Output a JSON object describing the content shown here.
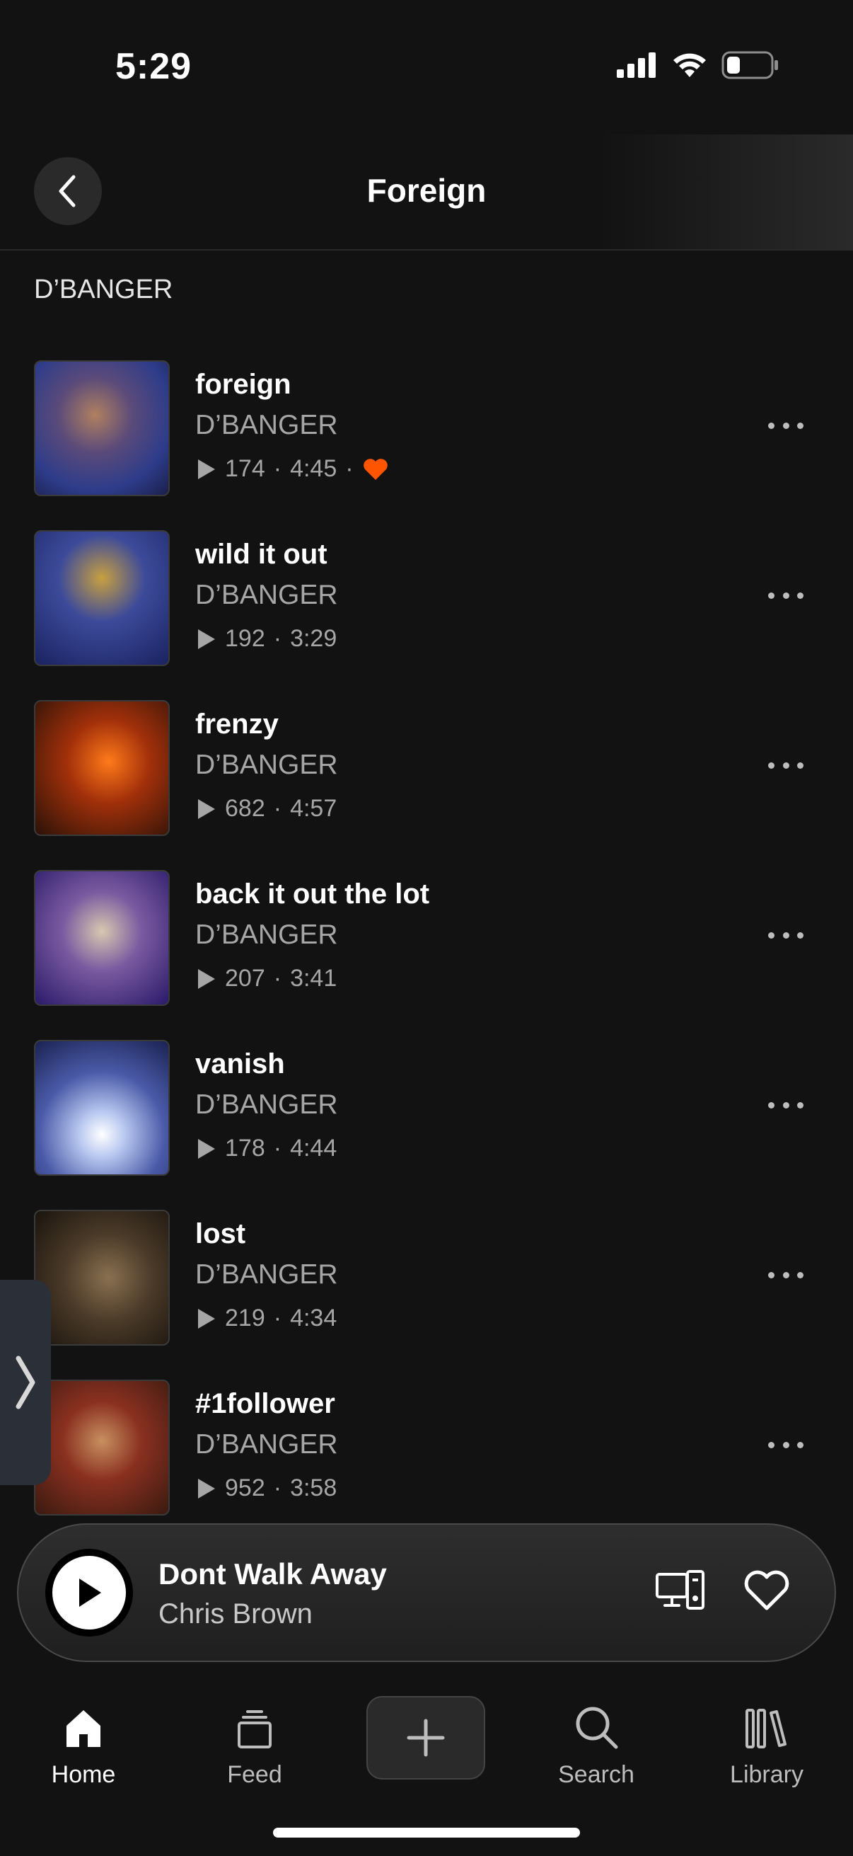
{
  "status_bar": {
    "time": "5:29"
  },
  "header": {
    "title": "Foreign"
  },
  "section": {
    "label": "D’BANGER"
  },
  "tracks": [
    {
      "title": "foreign",
      "artist": "D’BANGER",
      "plays": "174",
      "duration": "4:45",
      "liked": true
    },
    {
      "title": "wild it out",
      "artist": "D’BANGER",
      "plays": "192",
      "duration": "3:29",
      "liked": false
    },
    {
      "title": "frenzy",
      "artist": "D’BANGER",
      "plays": "682",
      "duration": "4:57",
      "liked": false
    },
    {
      "title": "back it out the lot",
      "artist": "D’BANGER",
      "plays": "207",
      "duration": "3:41",
      "liked": false
    },
    {
      "title": "vanish",
      "artist": "D’BANGER",
      "plays": "178",
      "duration": "4:44",
      "liked": false
    },
    {
      "title": "lost",
      "artist": "D’BANGER",
      "plays": "219",
      "duration": "4:34",
      "liked": false
    },
    {
      "title": "#1follower",
      "artist": "D’BANGER",
      "plays": "952",
      "duration": "3:58",
      "liked": false
    }
  ],
  "mini_player": {
    "title": "Dont Walk Away",
    "artist": "Chris Brown"
  },
  "nav": {
    "home": "Home",
    "feed": "Feed",
    "search": "Search",
    "library": "Library"
  },
  "colors": {
    "accent": "#ff5500",
    "background": "#121212"
  }
}
